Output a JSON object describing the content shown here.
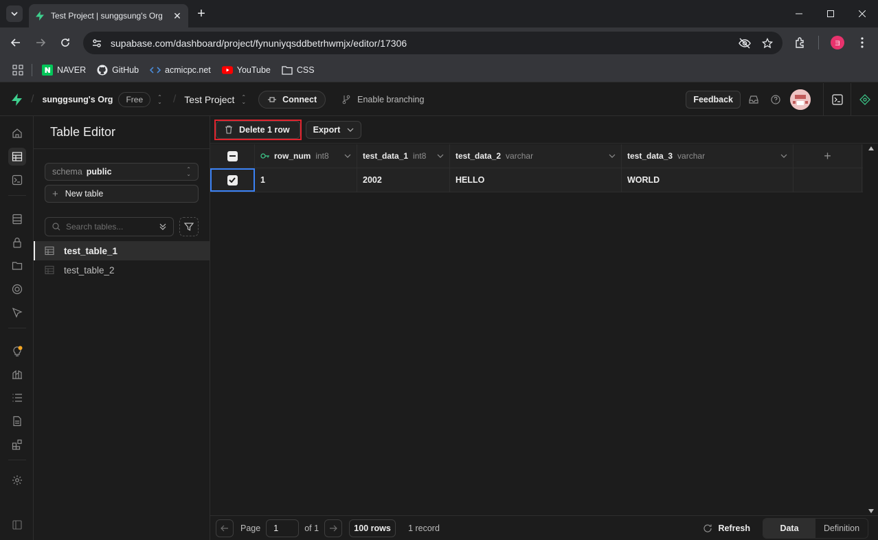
{
  "browser": {
    "tab_title": "Test Project | sunggsung's Org",
    "url": "supabase.com/dashboard/project/fynuniyqsddbetrhwmjx/editor/17306",
    "profile_initial": "ヨ",
    "bookmarks": [
      {
        "label": "NAVER",
        "icon": "naver-icon"
      },
      {
        "label": "GitHub",
        "icon": "github-icon"
      },
      {
        "label": "acmicpc.net",
        "icon": "code-icon"
      },
      {
        "label": "YouTube",
        "icon": "youtube-icon"
      },
      {
        "label": "CSS",
        "icon": "folder-icon"
      }
    ]
  },
  "topnav": {
    "org": "sunggsung's Org",
    "plan": "Free",
    "project": "Test Project",
    "connect": "Connect",
    "branching": "Enable branching",
    "feedback": "Feedback"
  },
  "sidebar": {
    "title": "Table Editor",
    "schema_label": "schema",
    "schema_value": "public",
    "new_table": "New table",
    "search_placeholder": "Search tables...",
    "tables": [
      "test_table_1",
      "test_table_2"
    ]
  },
  "toolbar": {
    "delete": "Delete 1 row",
    "export": "Export"
  },
  "grid": {
    "columns": [
      {
        "name": "row_num",
        "type": "int8"
      },
      {
        "name": "test_data_1",
        "type": "int8"
      },
      {
        "name": "test_data_2",
        "type": "varchar"
      },
      {
        "name": "test_data_3",
        "type": "varchar"
      }
    ],
    "rows": [
      [
        "1",
        "2002",
        "HELLO",
        "WORLD"
      ]
    ],
    "add_column": "+"
  },
  "footer": {
    "page_label": "Page",
    "page_value": "1",
    "of_label": "of 1",
    "rows_label": "100 rows",
    "record_count": "1 record",
    "refresh": "Refresh",
    "tab_data": "Data",
    "tab_definition": "Definition"
  },
  "colors": {
    "brand": "#3ecf8e",
    "highlight_box": "#e2242e",
    "selection": "#3b82f6"
  }
}
